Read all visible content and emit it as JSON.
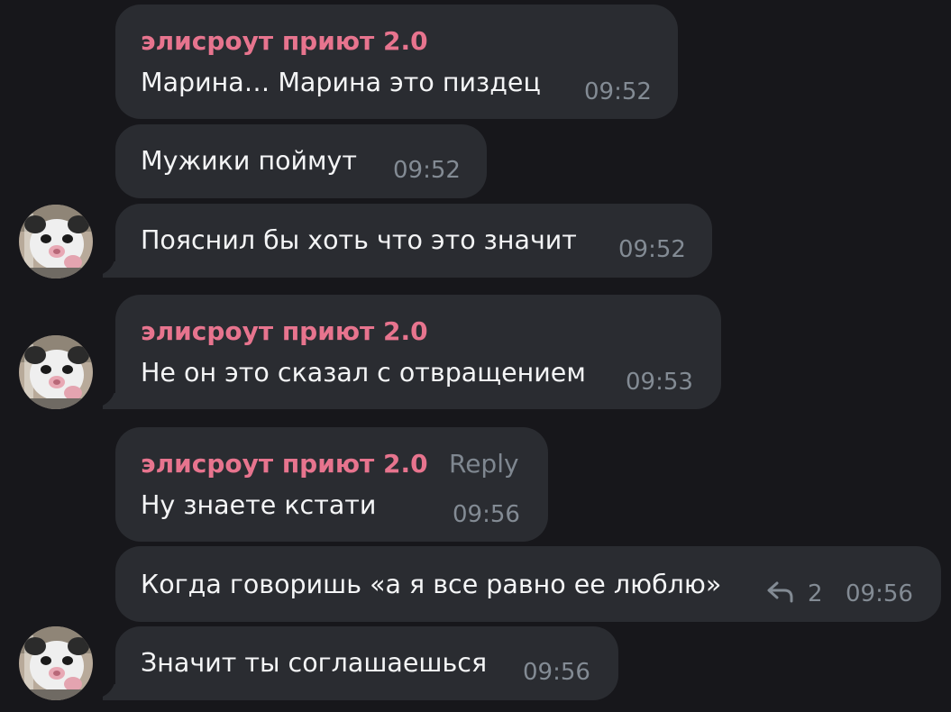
{
  "messages": [
    {
      "sender": "элисроут приют 2.0",
      "text": "Марина… Марина это пиздец",
      "time": "09:52"
    },
    {
      "text": "Мужики поймут",
      "time": "09:52"
    },
    {
      "text": "Пояснил бы хоть что это значит",
      "time": "09:52"
    },
    {
      "sender": "элисроут приют 2.0",
      "text": "Не он это сказал с отвращением",
      "time": "09:53"
    },
    {
      "sender": "элисроут приют 2.0",
      "reply_label": "Reply",
      "text": "Ну знаете кстати",
      "time": "09:56"
    },
    {
      "text": "Когда говоришь «а я все равно ее люблю»",
      "replies_count": "2",
      "time": "09:56"
    },
    {
      "text": "Значит ты соглашаешься",
      "time": "09:56"
    }
  ],
  "colors": {
    "background": "#17171b",
    "bubble": "#2a2c31",
    "sender": "#e7748e",
    "text": "#f4f5f6",
    "meta": "#838b94"
  }
}
